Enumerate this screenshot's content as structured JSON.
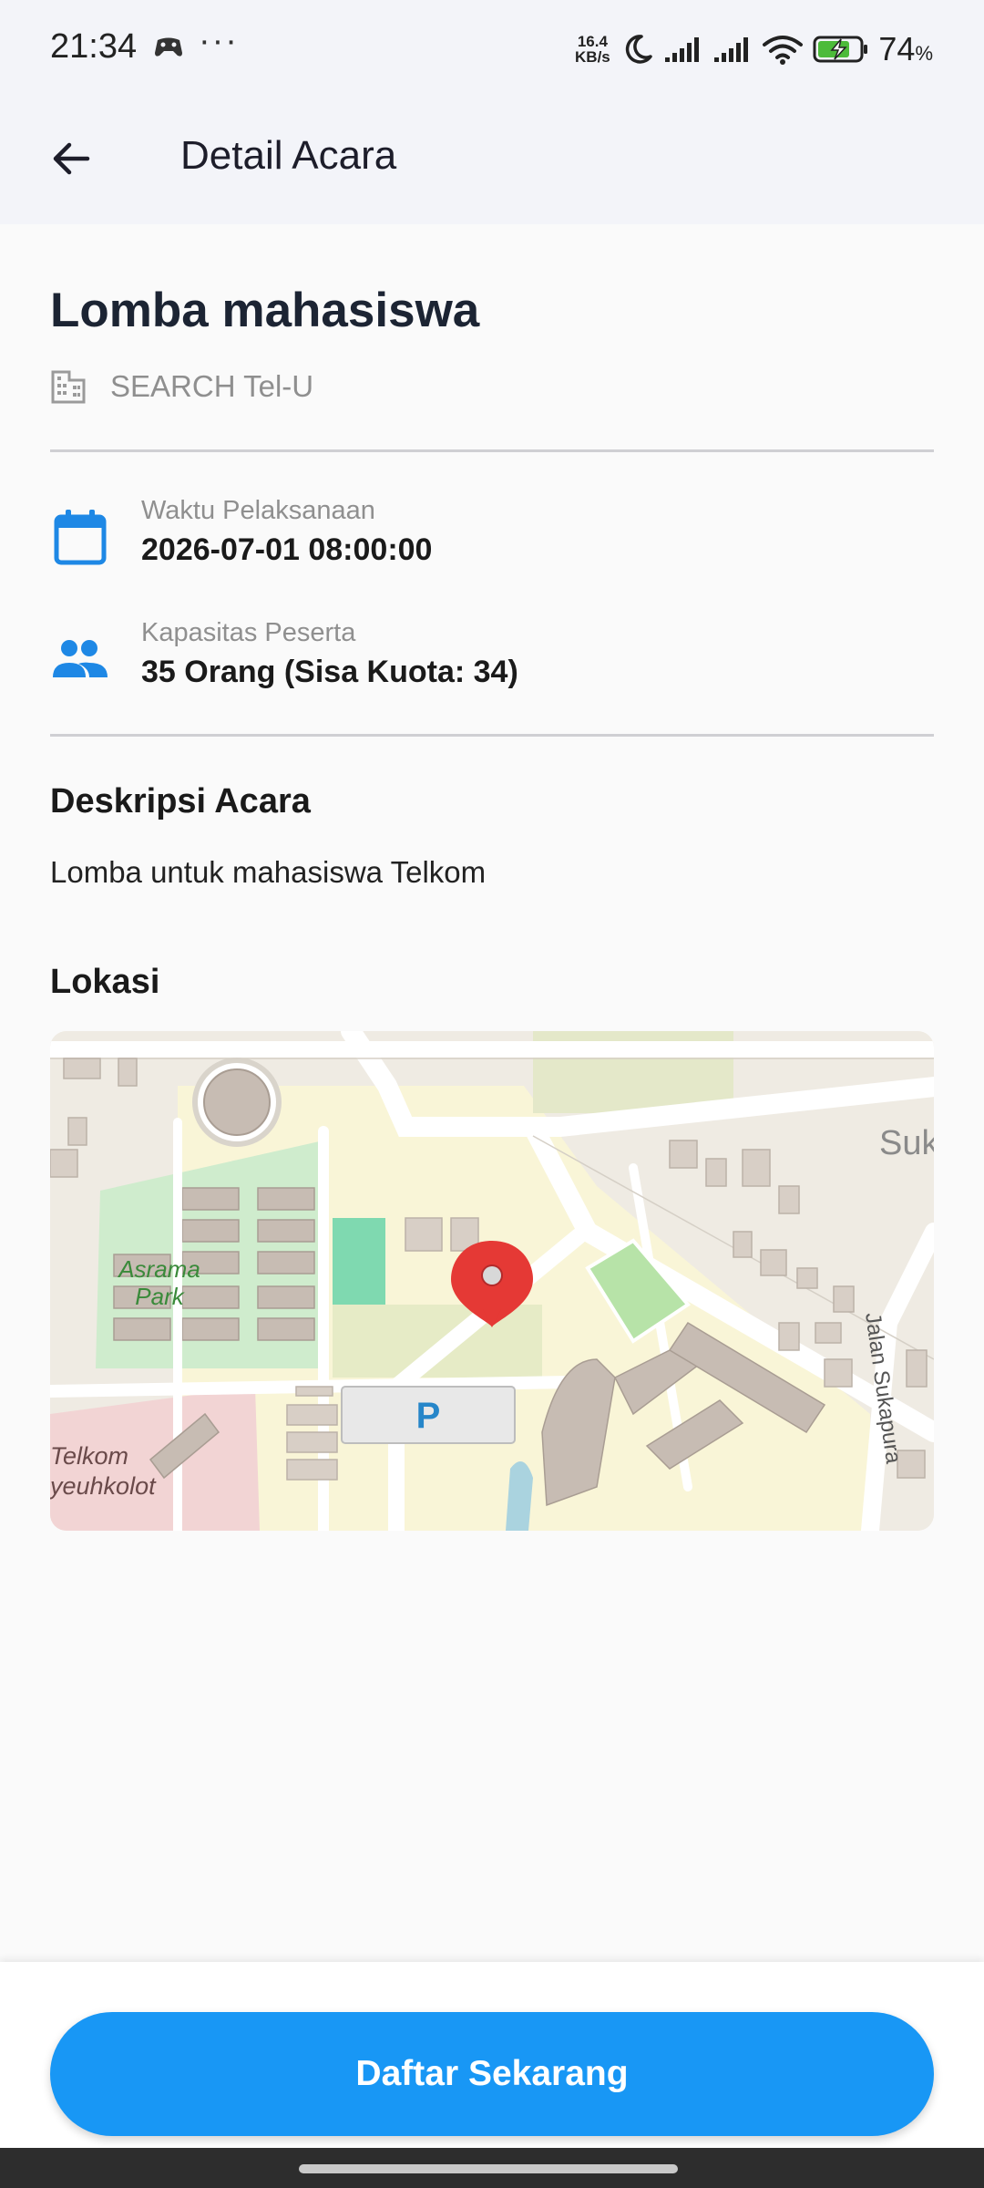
{
  "status_bar": {
    "time": "21:34",
    "dots": "···",
    "net_speed_value": "16.4",
    "net_speed_unit": "KB/s",
    "battery_percent": "74",
    "battery_percent_sign": "%",
    "icons": [
      "game-controller-icon",
      "moon-icon",
      "signal-icon",
      "signal-icon",
      "wifi-icon",
      "battery-charging-icon"
    ]
  },
  "app_bar": {
    "title": "Detail Acara",
    "back_icon": "arrow-left-icon"
  },
  "event": {
    "title": "Lomba mahasiswa",
    "organizer": "SEARCH Tel-U",
    "organizer_icon": "building-icon"
  },
  "details": [
    {
      "icon": "calendar-icon",
      "label": "Waktu Pelaksanaan",
      "value": "2026-07-01 08:00:00"
    },
    {
      "icon": "people-icon",
      "label": "Kapasitas Peserta",
      "value": "35 Orang (Sisa Kuota: 34)"
    }
  ],
  "description": {
    "heading": "Deskripsi Acara",
    "text": "Lomba untuk mahasiswa Telkom"
  },
  "location": {
    "heading": "Lokasi",
    "map_labels": {
      "park": "Asrama",
      "park2": "Park",
      "area_top_right": "Suk",
      "street": "Jalan Sukapura",
      "area_left1": "Telkom",
      "area_left2": "yeuhkolot",
      "parking": "P"
    },
    "marker_icon": "map-pin-icon"
  },
  "cta": {
    "label": "Daftar Sekarang"
  },
  "colors": {
    "primary": "#1897f5",
    "icon_blue": "#1e88e5",
    "marker_red": "#e53935"
  }
}
